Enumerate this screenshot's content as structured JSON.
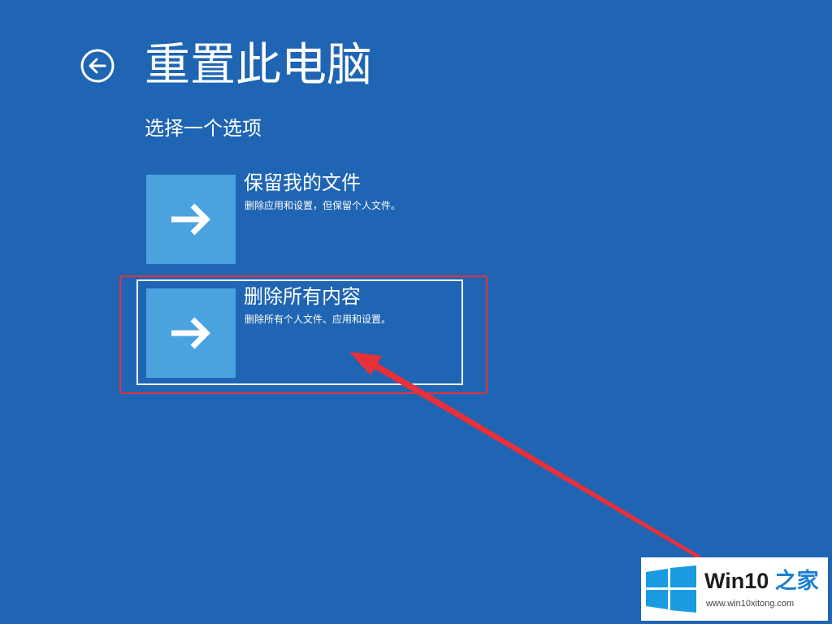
{
  "page": {
    "title": "重置此电脑",
    "subtitle": "选择一个选项"
  },
  "options": [
    {
      "title": "保留我的文件",
      "description": "删除应用和设置，但保留个人文件。",
      "icon": "arrow-right-icon"
    },
    {
      "title": "删除所有内容",
      "description": "删除所有个人文件、应用和设置。",
      "icon": "arrow-right-icon",
      "selected": true
    }
  ],
  "back_icon": "back-arrow-icon",
  "annotation": {
    "box_color": "#e8303a",
    "arrow_color": "#e8303a"
  },
  "watermark": {
    "brand_prefix": "Win10",
    "brand_suffix": "之家",
    "url": "www.win10xitong.com",
    "accent_color": "#1a7fd1"
  },
  "colors": {
    "background": "#1f65b3",
    "tile": "#4aa3df"
  }
}
